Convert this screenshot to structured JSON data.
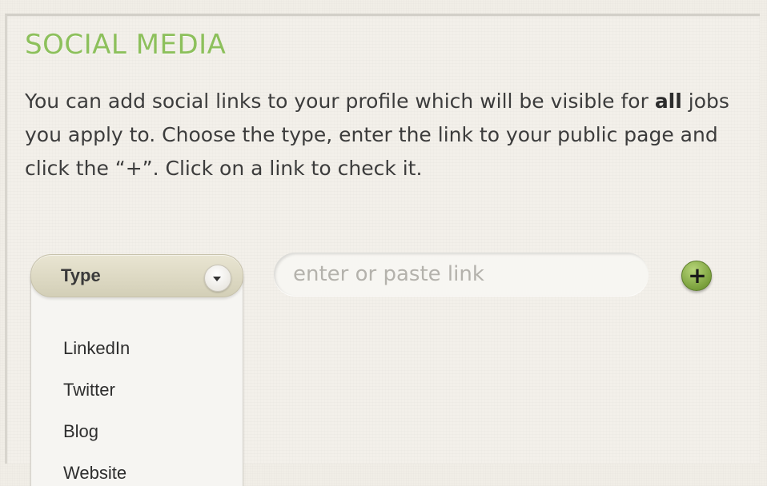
{
  "section": {
    "title": "SOCIAL MEDIA",
    "description_part1": "You can add social links to your profile which will be visible for ",
    "description_bold": "all",
    "description_part2": " jobs you apply to. Choose the type, enter the link to your public page and click the “+”. Click on a link to check it."
  },
  "type_select": {
    "label": "Type",
    "icon": "chevron-down-icon",
    "options": [
      "LinkedIn",
      "Twitter",
      "Blog",
      "Website"
    ]
  },
  "link_input": {
    "value": "",
    "placeholder": "enter or paste link"
  },
  "add_button": {
    "label": "+",
    "icon": "plus-icon",
    "color": "#7aa03c"
  },
  "colors": {
    "title": "#8dc05c",
    "background": "#f1eee7"
  }
}
